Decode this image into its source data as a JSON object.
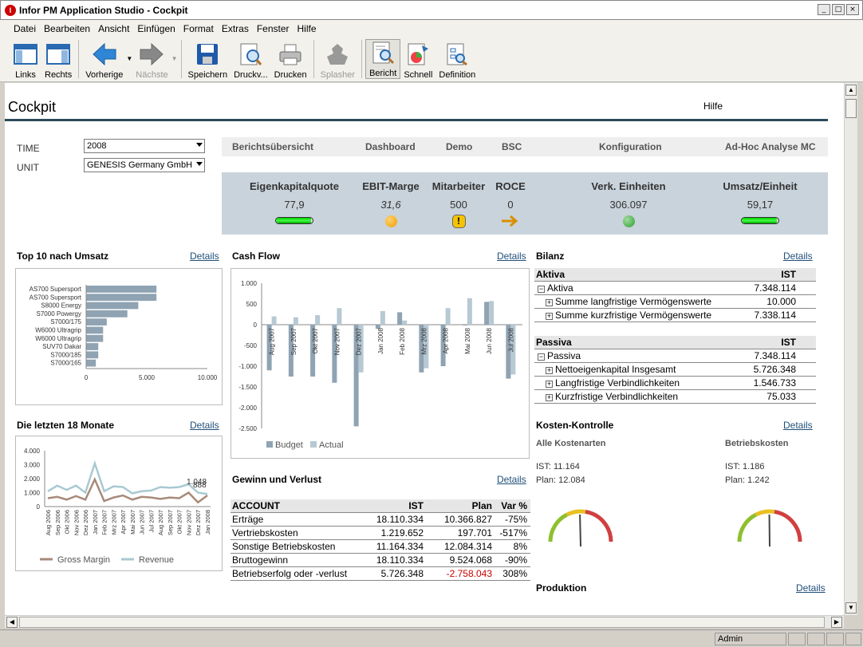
{
  "window": {
    "title": "Infor PM Application Studio - Cockpit",
    "controls": [
      "_",
      "□",
      "×"
    ]
  },
  "menu": [
    "Datei",
    "Bearbeiten",
    "Ansicht",
    "Einfügen",
    "Format",
    "Extras",
    "Fenster",
    "Hilfe"
  ],
  "toolbar": {
    "links": "Links",
    "rechts": "Rechts",
    "vorherige": "Vorherige",
    "naechste": "Nächste",
    "speichern": "Speichern",
    "druckv": "Druckv...",
    "drucken": "Drucken",
    "splasher": "Splasher",
    "bericht": "Bericht",
    "schnell": "Schnell",
    "definition": "Definition"
  },
  "page": {
    "title": "Cockpit",
    "help": "Hilfe"
  },
  "filters": {
    "time_label": "TIME",
    "time_value": "2008",
    "unit_label": "UNIT",
    "unit_value": "GENESIS Germany GmbH"
  },
  "nav": [
    "Berichtsübersicht",
    "Dashboard",
    "Demo",
    "BSC",
    "Konfiguration",
    "Ad-Hoc Analyse MC"
  ],
  "kpis": [
    {
      "title": "Eigenkapitalquote",
      "value": "77,9",
      "indicator": "bar",
      "level": 0.95
    },
    {
      "title": "EBIT-Marge",
      "value": "31,6",
      "indicator": "orange-dot"
    },
    {
      "title": "Mitarbeiter",
      "value": "500",
      "indicator": "warning-icon"
    },
    {
      "title": "ROCE",
      "value": "0",
      "indicator": "arrow-right"
    },
    {
      "title": "Verk. Einheiten",
      "value": "306.097",
      "indicator": "green-dot"
    },
    {
      "title": "Umsatz/Einheit",
      "value": "59,17",
      "indicator": "bar",
      "level": 0.95
    }
  ],
  "details": "Details",
  "top10": {
    "title": "Top 10 nach Umsatz"
  },
  "cashflow": {
    "title": "Cash Flow"
  },
  "last18": {
    "title": "Die letzten 18 Monate"
  },
  "bilanz": {
    "title": "Bilanz",
    "aktiva": {
      "header": "Aktiva",
      "col": "IST",
      "rows": [
        {
          "label": "Aktiva",
          "value": "7.348.114",
          "sign": "−",
          "indent": 0
        },
        {
          "label": "Summe langfristige Vermögenswerte",
          "value": "10.000",
          "sign": "+",
          "indent": 1
        },
        {
          "label": "Summe kurzfristige Vermögenswerte",
          "value": "7.338.114",
          "sign": "+",
          "indent": 1
        }
      ]
    },
    "passiva": {
      "header": "Passiva",
      "col": "IST",
      "rows": [
        {
          "label": "Passiva",
          "value": "7.348.114",
          "sign": "−",
          "indent": 0
        },
        {
          "label": "Nettoeigenkapital Insgesamt",
          "value": "5.726.348",
          "sign": "+",
          "indent": 1
        },
        {
          "label": "Langfristige Verbindlichkeiten",
          "value": "1.546.733",
          "sign": "+",
          "indent": 1
        },
        {
          "label": "Kurzfristige Verbindlichkeiten",
          "value": "75.033",
          "sign": "+",
          "indent": 1
        }
      ]
    }
  },
  "kosten": {
    "title": "Kosten-Kontrolle",
    "left": {
      "title": "Alle Kostenarten",
      "ist": "IST:  11.164",
      "plan": "Plan:  12.084",
      "needle": 0.46
    },
    "right": {
      "title": "Betriebskosten",
      "ist": "IST:  1.186",
      "plan": "Plan:  1.242",
      "needle": 0.48
    }
  },
  "guv": {
    "title": "Gewinn und Verlust",
    "headers": [
      "ACCOUNT",
      "IST",
      "Plan",
      "Var %"
    ],
    "rows": [
      [
        "Erträge",
        "18.110.334",
        "10.366.827",
        "-75%"
      ],
      [
        "Vertriebskosten",
        "1.219.652",
        "197.701",
        "-517%"
      ],
      [
        "Sonstige Betriebskosten",
        "11.164.334",
        "12.084.314",
        "8%"
      ],
      [
        "Bruttogewinn",
        "18.110.334",
        "9.524.068",
        "-90%"
      ],
      [
        "Betriebserfolg oder -verlust",
        "5.726.348",
        "-2.758.043",
        "308%"
      ]
    ]
  },
  "produktion": {
    "title": "Produktion"
  },
  "status": {
    "user": "Admin"
  },
  "colors": {
    "accent": "#2c4a5a",
    "bar": "#8fa3b2",
    "actual": "#b7c9d3",
    "gross": "#a88a7a",
    "revenue": "#a9c9d3"
  },
  "chart_data": [
    {
      "type": "bar",
      "orientation": "horizontal",
      "title": "Top 10 nach Umsatz",
      "categories": [
        "AS700 Supersport",
        "AS700 Supersport",
        "S8000 Energy",
        "S7000 Powergy",
        "S7000/175",
        "W6000 Ultragrip",
        "W6000 Ultragrip",
        "SUV70 Dakar",
        "S7000/185",
        "S7000/165"
      ],
      "values": [
        5800,
        5800,
        4300,
        3400,
        1700,
        1400,
        1400,
        1000,
        1000,
        800
      ],
      "xlim": [
        0,
        10000
      ],
      "xticks": [
        "0",
        "5.000",
        "10.000"
      ]
    },
    {
      "type": "bar",
      "title": "Cash Flow",
      "categories": [
        "Aug 2007",
        "Sep 2007",
        "Okt 2007",
        "Nov 2007",
        "Dez 2007",
        "Jan 2008",
        "Feb 2008",
        "Mrz 2008",
        "Apr 2008",
        "Mai 2008",
        "Jun 2008",
        "Jul 2008"
      ],
      "series": [
        {
          "name": "Budget",
          "values": [
            -1100,
            -1250,
            -1250,
            -1400,
            -2450,
            -100,
            300,
            -1150,
            -1000,
            0,
            550,
            -1300
          ]
        },
        {
          "name": "Actual",
          "values": [
            200,
            180,
            230,
            400,
            -1150,
            330,
            100,
            -1050,
            400,
            640,
            570,
            -1200
          ]
        }
      ],
      "ylim": [
        -2500,
        1000
      ],
      "yticks": [
        "1.000",
        "500",
        "0",
        "-500",
        "-1.000",
        "-1.500",
        "-2.000",
        "-2.500"
      ]
    },
    {
      "type": "line",
      "title": "Die letzten 18 Monate",
      "categories": [
        "Aug 2006",
        "Sep 2006",
        "Okt 2006",
        "Nov 2006",
        "Dez 2006",
        "Jan 2007",
        "Feb 2007",
        "Mrz 2007",
        "Apr 2007",
        "Mai 2007",
        "Jun 2007",
        "Jul 2007",
        "Aug 2007",
        "Sep 2007",
        "Okt 2007",
        "Nov 2007",
        "Dez 2007",
        "Jan 2008"
      ],
      "series": [
        {
          "name": "Gross Margin",
          "values": [
            600,
            700,
            500,
            750,
            500,
            1950,
            400,
            650,
            800,
            500,
            700,
            650,
            550,
            650,
            600,
            1000,
            300,
            800
          ]
        },
        {
          "name": "Revenue",
          "values": [
            1100,
            1500,
            1200,
            1500,
            1000,
            3100,
            1100,
            1450,
            1400,
            950,
            1100,
            1150,
            1400,
            1350,
            1400,
            1600,
            1000,
            900
          ]
        }
      ],
      "labels": [
        "1.048",
        "888"
      ],
      "ylim": [
        0,
        4000
      ],
      "yticks": [
        "4.000",
        "3.000",
        "2.000",
        "1.000",
        "0"
      ]
    }
  ]
}
